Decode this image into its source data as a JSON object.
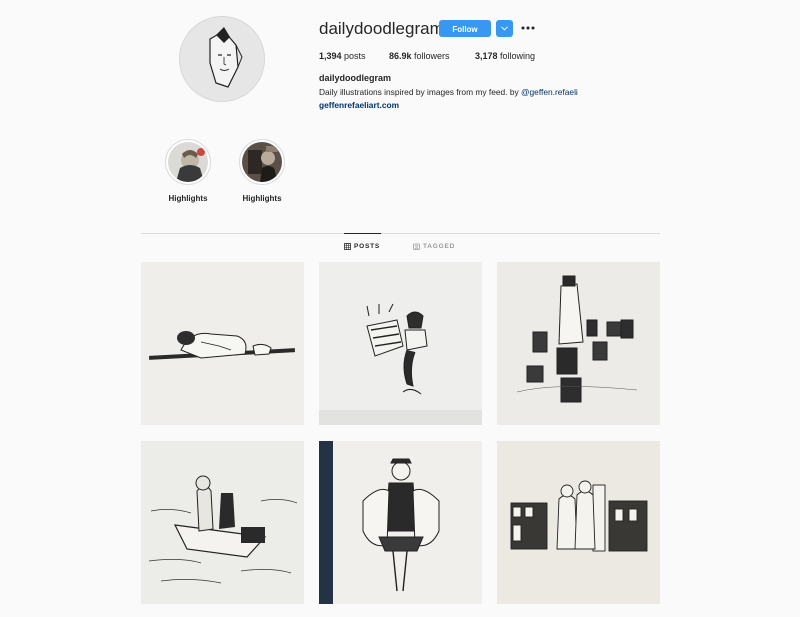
{
  "profile": {
    "username": "dailydoodlegram",
    "follow_label": "Follow",
    "posts_count": "1,394",
    "posts_label": "posts",
    "followers_count": "86.9k",
    "followers_label": "followers",
    "following_count": "3,178",
    "following_label": "following",
    "bio_name": "dailydoodlegram",
    "bio_text": "Daily illustrations inspired by images from my feed. by ",
    "bio_mention": "@geffen.refaeli",
    "bio_link": "geffenrefaeliart.com"
  },
  "highlights": [
    {
      "label": "Highlights"
    },
    {
      "label": "Highlights"
    }
  ],
  "tabs": {
    "posts": "POSTS",
    "tagged": "TAGGED"
  },
  "colors": {
    "accent": "#3897f0",
    "link": "#003569",
    "background": "#fafafa",
    "divider": "#dbdbdb"
  }
}
